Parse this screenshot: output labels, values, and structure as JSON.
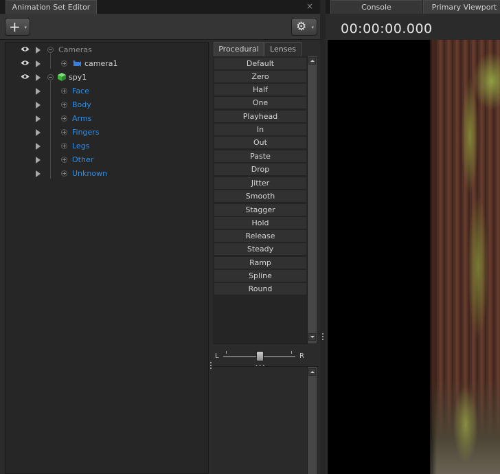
{
  "left_panel": {
    "tab_title": "Animation Set Editor",
    "close_glyph": "×",
    "toolbar": {
      "add_glyph": "+",
      "gear_glyph": "⚙",
      "caret_glyph": "▾"
    }
  },
  "tree": [
    {
      "label": "Cameras",
      "style": "gray",
      "eye": true,
      "expander": "minus",
      "icon": "",
      "indent": 0
    },
    {
      "label": "camera1",
      "style": "white",
      "eye": true,
      "expander": "plus",
      "icon": "camera-icon",
      "indent": 1
    },
    {
      "label": "spy1",
      "style": "white",
      "eye": true,
      "expander": "minus",
      "icon": "cube-icon",
      "indent": 0
    },
    {
      "label": "Face",
      "style": "blue",
      "eye": false,
      "expander": "plus",
      "icon": "",
      "indent": 1
    },
    {
      "label": "Body",
      "style": "blue",
      "eye": false,
      "expander": "plus",
      "icon": "",
      "indent": 1
    },
    {
      "label": "Arms",
      "style": "blue",
      "eye": false,
      "expander": "plus",
      "icon": "",
      "indent": 1
    },
    {
      "label": "Fingers",
      "style": "blue",
      "eye": false,
      "expander": "plus",
      "icon": "",
      "indent": 1
    },
    {
      "label": "Legs",
      "style": "blue",
      "eye": false,
      "expander": "plus",
      "icon": "",
      "indent": 1
    },
    {
      "label": "Other",
      "style": "blue",
      "eye": false,
      "expander": "plus",
      "icon": "",
      "indent": 1
    },
    {
      "label": "Unknown",
      "style": "blue",
      "eye": false,
      "expander": "plus",
      "icon": "",
      "indent": 1
    }
  ],
  "procedural": {
    "tabs": [
      "Procedural",
      "Lenses"
    ],
    "groups": [
      [
        "Default",
        "Zero",
        "Half",
        "One"
      ],
      [
        "Playhead",
        "In",
        "Out"
      ],
      [
        "Paste",
        "Drop"
      ],
      [
        "Jitter",
        "Smooth"
      ],
      [
        "Stagger",
        "Hold",
        "Release",
        "Steady"
      ],
      [
        "Ramp",
        "Spline",
        "Round"
      ]
    ],
    "balance_left": "L",
    "balance_right": "R",
    "balance_value": 0.5
  },
  "right_panel": {
    "tabs": [
      "Console",
      "Primary Viewport"
    ],
    "timecode": "00:00:00.000"
  },
  "colors": {
    "accent_blue": "#2f8ee6",
    "camera_icon": "#3b7fd9",
    "cube_icon": "#3fb23f"
  }
}
